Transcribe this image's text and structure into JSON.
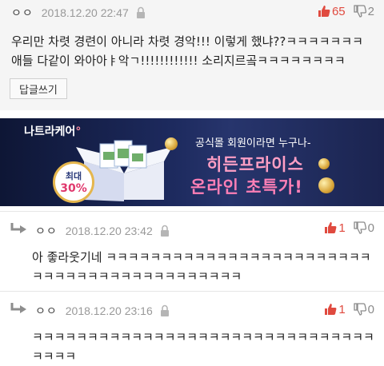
{
  "top_comment": {
    "author": "ㅇㅇ",
    "date": "2018.12.20 22:47",
    "upvotes": "65",
    "downvotes": "2",
    "text": "우리만 차렷 경련이 아니라 차렷 경악!!! 이렇게 했냐??ㅋㅋㅋㅋㅋㅋㅋ 애들 다같이 와아아ㅑ악ㄱ!!!!!!!!!!!! 소리지르곸ㅋㅋㅋㅋㅋㅋㅋㅋ",
    "reply_button": "답글쓰기"
  },
  "ad": {
    "brand": "나트라케어",
    "badge_top": "최대",
    "badge_value": "30%",
    "line1": "공식몰 회원이라면 누구나-",
    "line2": "히든프라이스",
    "line3": "온라인 초특가!"
  },
  "replies": [
    {
      "author": "ㅇㅇ",
      "date": "2018.12.20 23:42",
      "upvotes": "1",
      "downvotes": "0",
      "text": "아 좋라웃기네 ㅋㅋㅋㅋㅋㅋㅋㅋㅋㅋㅋㅋㅋㅋㅋㅋㅋㅋㅋㅋㅋㅋㅋㅋㅋㅋㅋㅋㅋㅋㅋㅋㅋㅋㅋㅋㅋㅋㅋㅋㅋㅋㅋ"
    },
    {
      "author": "ㅇㅇ",
      "date": "2018.12.20 23:16",
      "upvotes": "1",
      "downvotes": "0",
      "text": "ㅋㅋㅋㅋㅋㅋㅋㅋㅋㅋㅋㅋㅋㅋㅋㅋㅋㅋㅋㅋㅋㅋㅋㅋㅋㅋㅋㅋㅋㅋㅋㅋㅋㅋㅋ"
    }
  ],
  "colors": {
    "upvote": "#e04a3f",
    "downvote": "#8a8a8a",
    "top_comment_bg": "#f5f5f5"
  },
  "icons": {
    "thumb_up": "thumbs-up-icon",
    "thumb_down": "thumbs-down-icon",
    "report": "lock-report-icon",
    "reply": "reply-arrow-icon"
  }
}
